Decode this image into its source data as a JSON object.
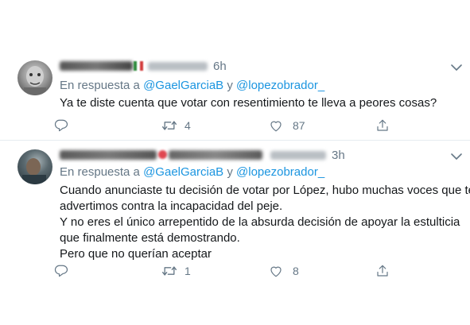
{
  "colors": {
    "link": "#1b95e0",
    "secondary": "#657786",
    "text": "#14171a",
    "divider": "#e6ecf0"
  },
  "tweets": [
    {
      "time": "6h",
      "reply_prefix": "En respuesta a",
      "mention1": "@GaelGarciaB",
      "conj": "y",
      "mention2": "@lopezobrador_",
      "lines": [
        "Ya te diste cuenta que votar con resentimiento te lleva a peores cosas?"
      ],
      "reply_count": "",
      "retweet_count": "4",
      "like_count": "87",
      "icons": [
        "reply-icon",
        "retweet-icon",
        "like-icon",
        "share-icon",
        "chevron-down-icon"
      ]
    },
    {
      "time": "3h",
      "reply_prefix": "En respuesta a",
      "mention1": "@GaelGarciaB",
      "conj": "y",
      "mention2": "@lopezobrador_",
      "lines": [
        "Cuando anunciaste tu decisión de votar por López, hubo muchas voces que te",
        "advertimos contra la incapacidad del peje.",
        "Y no eres el único arrepentido de la absurda decisión de apoyar la estulticia",
        "que finalmente está demostrando.",
        "Pero que no querían aceptar"
      ],
      "reply_count": "",
      "retweet_count": "1",
      "like_count": "8",
      "icons": [
        "reply-icon",
        "retweet-icon",
        "like-icon",
        "share-icon",
        "chevron-down-icon"
      ]
    }
  ]
}
